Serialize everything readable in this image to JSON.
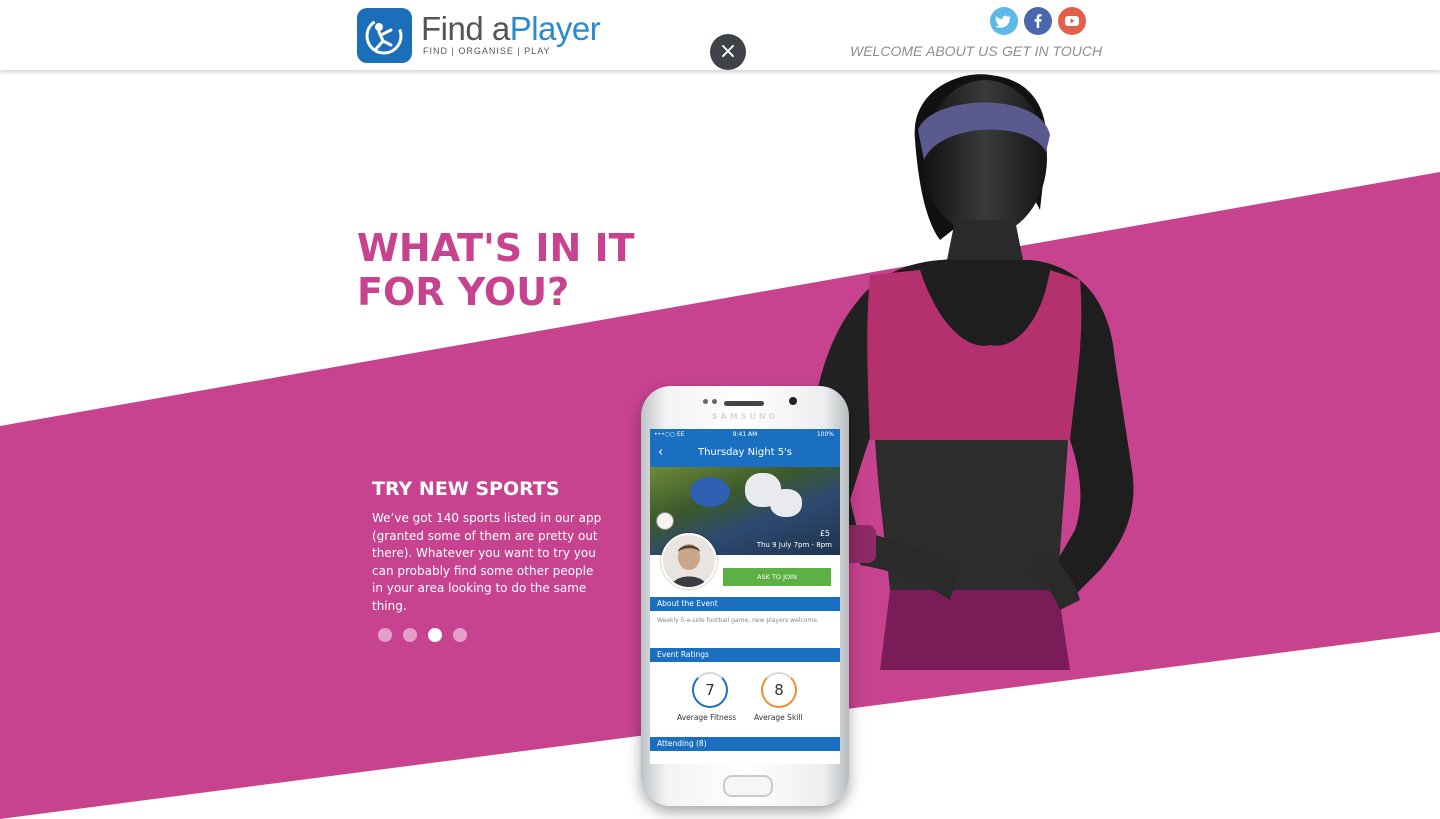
{
  "header": {
    "logo_text_find": "Find a",
    "logo_text_player": "Player",
    "tagline": "FIND | ORGANISE | PLAY",
    "close_label": "×",
    "nav": [
      "WELCOME",
      "ABOUT US",
      "GET IN TOUCH"
    ],
    "social": [
      "twitter-icon",
      "facebook-icon",
      "youtube-icon"
    ]
  },
  "hero": {
    "headline_line1": "WHAT'S IN IT",
    "headline_line2": "FOR YOU?"
  },
  "slide": {
    "title": "TRY NEW SPORTS",
    "body": "We’ve got 140 sports listed in our app (granted some of them are pretty out there). Whatever you want to try you can probably find some other people in your area looking to do the same thing.",
    "dots_total": 4,
    "dots_active_index": 2
  },
  "phone": {
    "brand": "SAMSUNG",
    "status_carrier": "•••○○ EE",
    "status_time": "9:41 AM",
    "status_battery": "100%",
    "screen_title": "Thursday Night 5's",
    "price": "£5",
    "event_date": "Thu 9 July 7pm - 8pm",
    "join_label": "ASK TO JOIN",
    "about_title": "About the Event",
    "about_body": "Weekly 5-a-side football game, new players welcome.",
    "ratings_title": "Event Ratings",
    "fitness_value": "7",
    "fitness_label": "Average Fitness",
    "skill_value": "8",
    "skill_label": "Average Skill",
    "attending_title": "Attending (8)"
  },
  "colors": {
    "magenta": "#c7438f",
    "blue": "#1a6fc0",
    "green": "#5db044"
  }
}
